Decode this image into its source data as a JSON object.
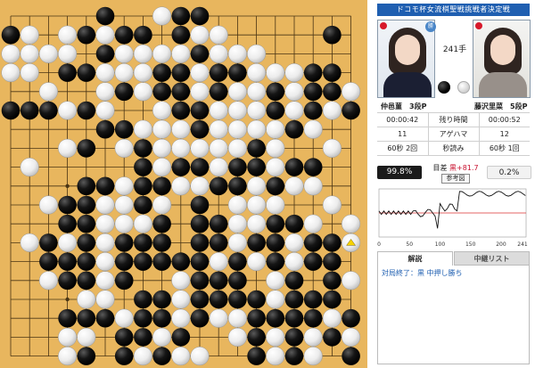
{
  "header": {
    "title": "ドコモ杯女流棋聖戦挑戦者決定戦"
  },
  "players": {
    "black": {
      "name": "仲邑菫　3段P",
      "time_used": "00:00:42",
      "captures": "11",
      "byoyomi": "60秒 2回"
    },
    "white": {
      "name": "藤沢里菜　5段P",
      "time_used": "00:00:52",
      "captures": "12",
      "byoyomi": "60秒 1回"
    }
  },
  "move_count": "241手",
  "win_badge": "勝",
  "stats_labels": {
    "time_left": "残り時間",
    "captures": "アゲハマ",
    "byoyomi": "秒読み"
  },
  "eval": {
    "black_pct": "99.8%",
    "white_pct": "0.2%",
    "label": "目差",
    "value": "黒+81.7",
    "ref_button": "参考図"
  },
  "graph": {
    "x_ticks": [
      "0",
      "50",
      "100",
      "150",
      "200",
      "241"
    ]
  },
  "tabs": [
    {
      "label": "解説"
    },
    {
      "label": "中継リスト"
    }
  ],
  "comment": "対局終了：黒 中押し勝ち",
  "colors": {
    "title_bar": "#1f5fb1",
    "board": "#e8b65e",
    "eval_value": "#c8102e",
    "comment_text": "#1f5fb1"
  },
  "board": {
    "size": 19,
    "last_move": [
      18,
      12
    ],
    "rows": [
      ".....B..WBB........",
      "BW.WBWBB.BWW.....B.",
      "WWWW.BWWWWBWWW.....",
      "WW.BBWWWBBWBBWWWBB.",
      "..W..WBWBBWBWWBWBBW",
      "BBBWBW..WBBWWWBWBWB",
      ".....BBWWWBWWWWBW..",
      "...WB.WBWWWWWBW..W.",
      ".W.....BWBBWBBWBB..",
      "....BBWBBWWBBWBWW..",
      "..WBBWWBW.B.WWW..W.",
      "...BBWWWB.BBWWBBW.W",
      ".WBWBWBBB.BBWBBWBBW",
      "..BBBWBBBBBWBWBWBB.",
      "..WBBWB..WBBB.WB.BW",
      "....WW.BBWBBBBWBBB.",
      "...BBBWBBWBWWBBBBWB",
      "...WW.BBWB..WBWBWBW",
      "...WB.BWBWW..BWBW.B"
    ]
  }
}
